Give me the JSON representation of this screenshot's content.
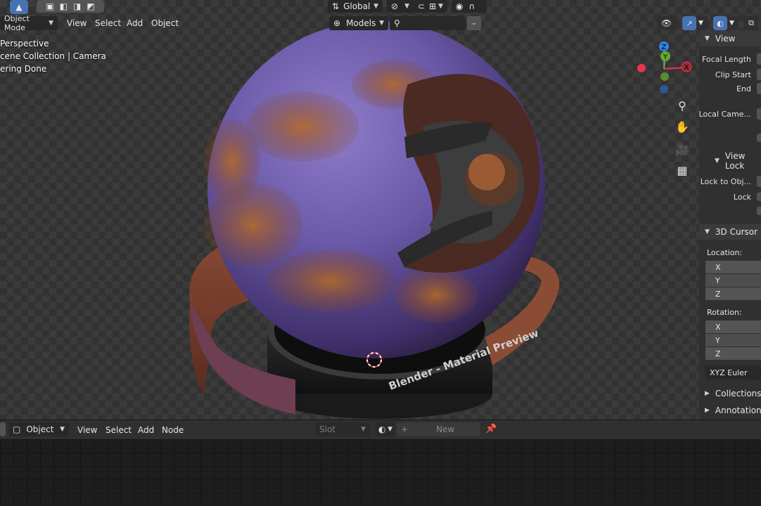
{
  "toolbar": {
    "transform_orientation": "Global",
    "mode": "Object Mode",
    "menus": [
      "View",
      "Select",
      "Add",
      "Object"
    ],
    "shading_collection": "Models"
  },
  "overlay_info": {
    "line1": "Perspective",
    "line2": "cene Collection | Camera",
    "line3": "ering Done"
  },
  "gizmo": {
    "axis_x": "X",
    "axis_y": "Y",
    "axis_z": "Z",
    "color_x": "#e8344f",
    "color_y": "#6aa532",
    "color_z": "#2f84e3"
  },
  "render": {
    "pedestal_text": "Blender - Material Preview"
  },
  "npanel": {
    "view_header": "View",
    "focal_length": "Focal Length",
    "clip_start": "Clip Start",
    "end": "End",
    "local_camera": "Local Came...",
    "view_lock_header": "View Lock",
    "lock_to_object": "Lock to Obj...",
    "lock": "Lock",
    "cursor_header": "3D Cursor",
    "location": "Location:",
    "rotation": "Rotation:",
    "loc_x": "X",
    "loc_y": "Y",
    "loc_z": "Z",
    "rot_x": "X",
    "rot_y": "Y",
    "rot_z": "Z",
    "rotation_mode": "XYZ Euler",
    "collections": "Collections",
    "annotations": "Annotations"
  },
  "node_editor": {
    "object_type": "Object",
    "menus": [
      "View",
      "Select",
      "Add",
      "Node"
    ],
    "slot_placeholder": "Slot",
    "new_label": "New"
  }
}
